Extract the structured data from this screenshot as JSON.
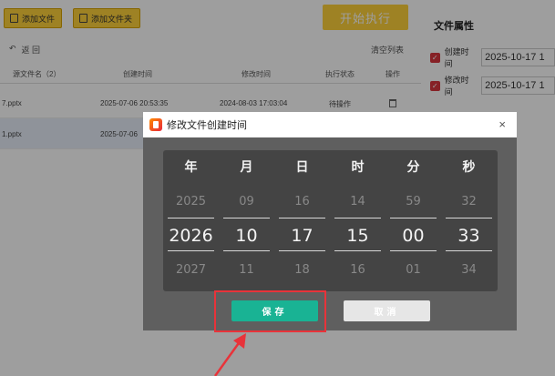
{
  "toolbar": {
    "add_file": "添加文件",
    "add_folder": "添加文件夹",
    "start": "开始执行"
  },
  "list": {
    "back": "返 回",
    "clear": "清空列表",
    "columns": [
      "源文件名（2）",
      "创建时间",
      "修改时间",
      "执行状态",
      "操作"
    ],
    "rows": [
      {
        "name": "7.pptx",
        "created": "2025-07-06 20:53:35",
        "modified": "2024-08-03 17:03:04",
        "status": "待操作"
      },
      {
        "name": "1.pptx",
        "created": "2025-07-06"
      }
    ]
  },
  "props": {
    "title": "文件属性",
    "created_label": "创建时间",
    "created_value": "2025-10-17 1",
    "modified_label": "修改时间",
    "modified_value": "2025-10-17 1"
  },
  "dialog": {
    "title": "修改文件创建时间",
    "close": "×",
    "columns": [
      {
        "label": "年",
        "prev": "2025",
        "current": "2026",
        "next": "2027"
      },
      {
        "label": "月",
        "prev": "09",
        "current": "10",
        "next": "11"
      },
      {
        "label": "日",
        "prev": "16",
        "current": "17",
        "next": "18"
      },
      {
        "label": "时",
        "prev": "14",
        "current": "15",
        "next": "16"
      },
      {
        "label": "分",
        "prev": "59",
        "current": "00",
        "next": "01"
      },
      {
        "label": "秒",
        "prev": "32",
        "current": "33",
        "next": "34"
      }
    ],
    "save": "保存",
    "cancel": "取消"
  },
  "colors": {
    "accent_yellow": "#ffd23a",
    "save_green": "#19b394",
    "highlight_red": "#e8333a"
  }
}
